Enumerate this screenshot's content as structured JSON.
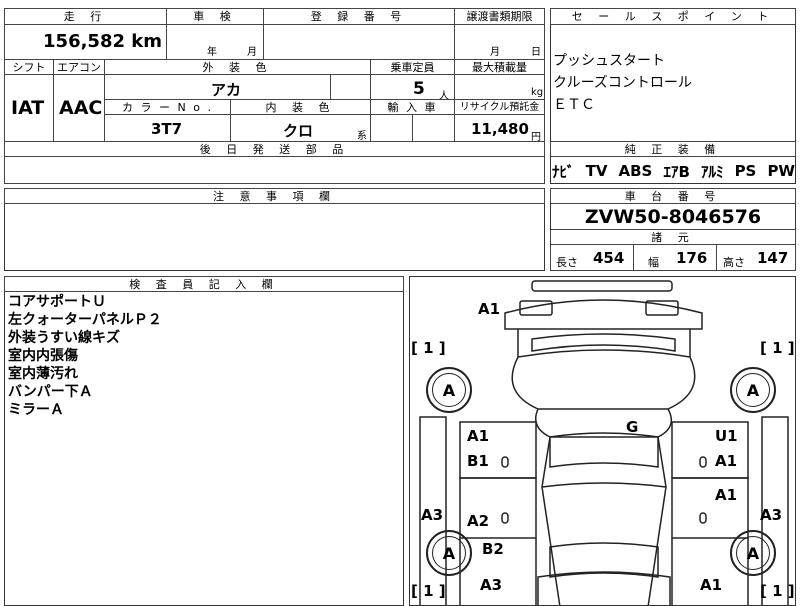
{
  "top_left_fragment": "",
  "grid": {
    "h_mileage": "走 行",
    "mileage": "156,582 km",
    "h_inspection": "車 検",
    "inspection_year": "年",
    "inspection_month": "月",
    "h_registration": "登 録 番 号",
    "h_transfer": "譲渡書類期限",
    "transfer_month": "月",
    "transfer_day": "日",
    "h_shift": "シフト",
    "h_aircon": "エアコン",
    "h_exterior": "外 装 色",
    "h_capacity": "乗車定員",
    "h_maxload": "最大積載量",
    "shift": "IAT",
    "aircon": "AAC",
    "exterior_color": "アカ",
    "capacity": "5",
    "capacity_unit": "人",
    "maxload_unit": "kg",
    "h_color_no": "カ ラ ー N o .",
    "h_interior": "内 装 色",
    "h_import": "輸 入 車",
    "h_recycle": "リサイクル預託金",
    "color_no": "3T7",
    "interior_color": "クロ",
    "interior_suffix": "系",
    "recycle_fee": "11,480",
    "recycle_unit": "円",
    "h_later_parts": "後 日 発 送 部 品"
  },
  "sales_points": {
    "header": "セ ー ル ス ポ イ ン ト",
    "items": [
      "プッシュスタート",
      "クルーズコントロール",
      "ＥＴＣ"
    ]
  },
  "equipment": {
    "header": "純 正 装 備",
    "items": [
      "ﾅﾋﾞ",
      "TV",
      "ABS",
      "ｴｱB",
      "ｱﾙﾐ",
      "PS",
      "PW"
    ]
  },
  "notes": {
    "header": "注 意 事 項 欄"
  },
  "chassis": {
    "header": "車 台 番 号",
    "number": "ZVW50-8046576",
    "specs_header": "諸 元",
    "length_label": "長さ",
    "length": "454",
    "width_label": "幅",
    "width": "176",
    "height_label": "高さ",
    "height": "147"
  },
  "inspector": {
    "header": "検 査 員 記 入 欄",
    "remarks": [
      "コアサポートＵ",
      "左クォーターパネルＰ２",
      "外装うすい線キズ",
      "室内内張傷",
      "室内薄汚れ",
      "バンパー下Ａ",
      "ミラーＡ"
    ]
  },
  "diagram": {
    "bracket_tl": "[ 1 ]",
    "bracket_tr": "[ 1 ]",
    "bracket_bl": "[ 1 ]",
    "bracket_br": "[ 1 ]",
    "wheel_fl": "A",
    "wheel_fr": "A",
    "wheel_rl": "A",
    "wheel_rr": "A",
    "front": "A1",
    "windshield": "G",
    "l_front_door_1": "A1",
    "l_front_door_2": "B1",
    "r_front_door_1": "U1",
    "r_front_door_2": "A1",
    "r_rear_door": "A1",
    "l_rear_door": "A2",
    "l_rear": "B2",
    "l_side": "A3",
    "r_side": "A3",
    "rear_left": "A3",
    "rear_right": "A1"
  }
}
